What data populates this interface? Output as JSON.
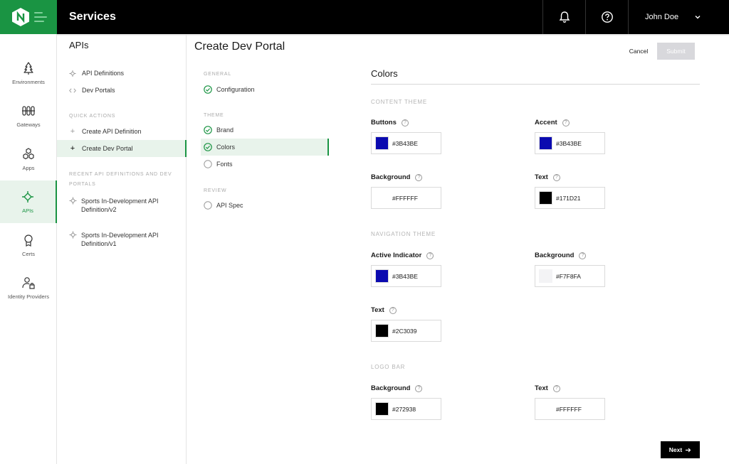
{
  "app": {
    "title": "Services",
    "user": "John Doe"
  },
  "rail": {
    "items": [
      {
        "label": "Environments",
        "icon": "tree-icon"
      },
      {
        "label": "Gateways",
        "icon": "gateway-icon"
      },
      {
        "label": "Apps",
        "icon": "apps-icon"
      },
      {
        "label": "APIs",
        "icon": "api-icon",
        "active": true
      },
      {
        "label": "Certs",
        "icon": "certificate-icon"
      },
      {
        "label": "Identity Providers",
        "icon": "identity-icon"
      }
    ]
  },
  "secnav": {
    "title": "APIs",
    "items": [
      {
        "label": "API Definitions",
        "icon": "api-definition-icon"
      },
      {
        "label": "Dev Portals",
        "icon": "code-icon"
      }
    ],
    "quick_actions_heading": "QUICK ACTIONS",
    "quick_actions": [
      {
        "label": "Create API Definition"
      },
      {
        "label": "Create Dev Portal",
        "active": true
      }
    ],
    "recent_heading": "RECENT API DEFINITIONS AND DEV PORTALS",
    "recent": [
      {
        "label": "Sports In-Development API Definition/v2"
      },
      {
        "label": "Sports In-Development API Definition/v1"
      }
    ]
  },
  "page": {
    "title": "Create Dev Portal",
    "cancel_label": "Cancel",
    "submit_label": "Submit",
    "next_label": "Next"
  },
  "stepper": {
    "general_heading": "GENERAL",
    "theme_heading": "THEME",
    "review_heading": "REVIEW",
    "steps": [
      {
        "label": "Configuration",
        "status": "complete"
      },
      {
        "label": "Brand",
        "status": "complete"
      },
      {
        "label": "Colors",
        "status": "complete",
        "active": true
      },
      {
        "label": "Fonts",
        "status": "pending"
      },
      {
        "label": "API Spec",
        "status": "pending"
      }
    ]
  },
  "colors": {
    "title": "Colors",
    "content_theme_heading": "CONTENT THEME",
    "navigation_theme_heading": "NAVIGATION THEME",
    "logo_bar_heading": "LOGO BAR",
    "content": {
      "buttons": {
        "label": "Buttons",
        "value": "#3B43BE",
        "swatch": "#0b0ab0"
      },
      "accent": {
        "label": "Accent",
        "value": "#3B43BE",
        "swatch": "#0b0ab0"
      },
      "background": {
        "label": "Background",
        "value": "#FFFFFF",
        "swatch": "#FFFFFF"
      },
      "text": {
        "label": "Text",
        "value": "#171D21",
        "swatch": "#000000"
      }
    },
    "navigation": {
      "active_indicator": {
        "label": "Active Indicator",
        "value": "#3B43BE",
        "swatch": "#0b0ab0"
      },
      "background": {
        "label": "Background",
        "value": "#F7F8FA",
        "swatch": "#F7F8FA"
      },
      "text": {
        "label": "Text",
        "value": "#2C3039",
        "swatch": "#000000"
      }
    },
    "logo_bar": {
      "background": {
        "label": "Background",
        "value": "#272938",
        "swatch": "#000000"
      },
      "text": {
        "label": "Text",
        "value": "#FFFFFF",
        "swatch": "#FFFFFF"
      }
    }
  },
  "theme_colors": {
    "brand_green": "#1a9443",
    "active_bg": "#e8f3eb",
    "topbar": "#000000"
  }
}
